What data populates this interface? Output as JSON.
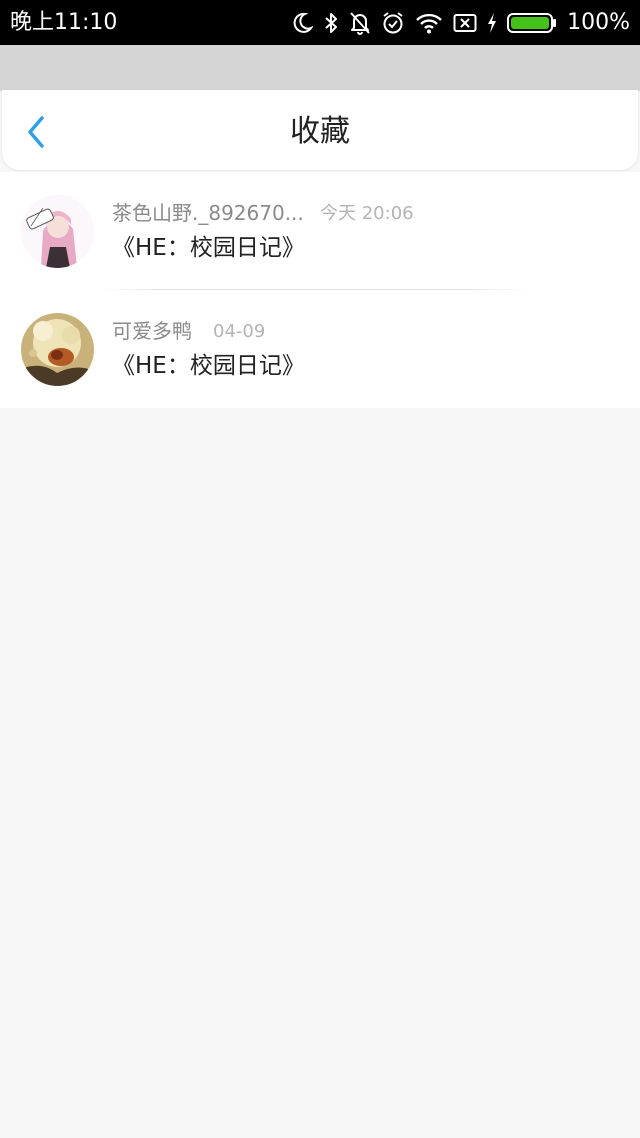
{
  "status_bar": {
    "time": "晚上11:10",
    "battery": "100%",
    "icons": [
      "moon-icon",
      "bluetooth-icon",
      "mute-bell-icon",
      "alarm-icon",
      "wifi-icon",
      "no-sim-icon",
      "charging-icon",
      "battery-icon"
    ],
    "battery_color": "#44c21a"
  },
  "header": {
    "back_icon": "chevron-left-icon",
    "title": "收藏",
    "accent": "#2ea0e8"
  },
  "favorites": [
    {
      "name": "茶色山野._892670...",
      "time": "今天 20:06",
      "title": "《HE：校园日记》",
      "avatar": "avatar-pink-hair-girl"
    },
    {
      "name": "可爱多鸭",
      "time": "04-09",
      "title": "《HE：校园日记》",
      "avatar": "avatar-golden-illustration"
    }
  ]
}
